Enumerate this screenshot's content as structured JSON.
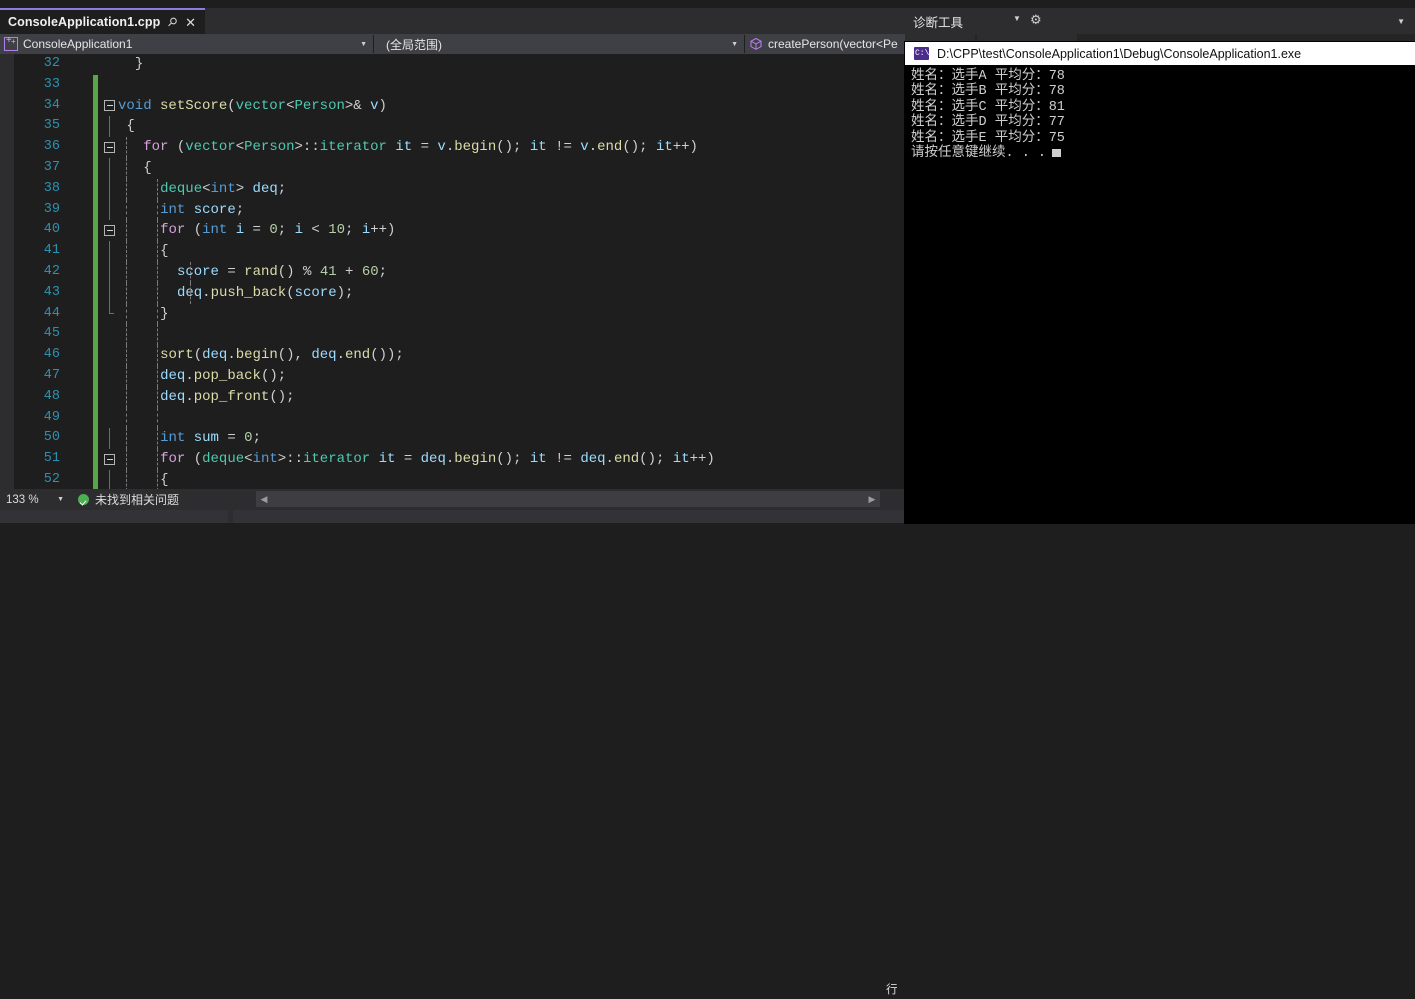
{
  "window": {
    "tab": {
      "title": "ConsoleApplication1.cpp",
      "pin_icon": "pin-icon",
      "close_icon": "close-icon"
    }
  },
  "navbar": {
    "project_selector": "ConsoleApplication1",
    "project_icon": "cpp-project-icon",
    "scope_selector": "(全局范围)",
    "member_selector": "createPerson(vector<Pe",
    "member_icon": "method-cube-icon",
    "dropdown_icon": "chevron-down-icon"
  },
  "diagnostics": {
    "title": "诊断工具",
    "dropdown_icon": "chevron-down-icon",
    "settings_icon": "gear-icon",
    "window_arrow_icon": "chevron-down-icon"
  },
  "console": {
    "title": "D:\\CPP\\test\\ConsoleApplication1\\Debug\\ConsoleApplication1.exe",
    "icon": "console-exe-icon",
    "lines": [
      "姓名：选手A 平均分：78",
      "姓名：选手B 平均分：78",
      "姓名：选手C 平均分：81",
      "姓名：选手D 平均分：77",
      "姓名：选手E 平均分：75",
      "请按任意键继续. . ."
    ],
    "cursor": "block-cursor"
  },
  "statusbar": {
    "zoom": "133 %",
    "zoom_arrow_icon": "chevron-down-icon",
    "issues_icon": "check-circle-icon",
    "issues_text": "未找到相关问题",
    "scroll_left_icon": "caret-left-icon",
    "scroll_right_icon": "caret-right-icon",
    "rowcol_label": "行"
  },
  "editor": {
    "first_line": 32,
    "lines": [
      {
        "n": 32,
        "change": false,
        "glyph": "",
        "guides": 0,
        "indent": 2,
        "tokens": [
          {
            "t": "}",
            "c": "brc"
          }
        ]
      },
      {
        "n": 33,
        "change": true,
        "glyph": "",
        "guides": 0,
        "indent": 0,
        "tokens": []
      },
      {
        "n": 34,
        "change": true,
        "glyph": "collapse",
        "guides": 0,
        "indent": 0,
        "tokens": [
          {
            "t": "void",
            "c": "k"
          },
          {
            "t": " ",
            "c": "pun"
          },
          {
            "t": "setScore",
            "c": "fn"
          },
          {
            "t": "(",
            "c": "brc"
          },
          {
            "t": "vector",
            "c": "typ"
          },
          {
            "t": "<",
            "c": "brc"
          },
          {
            "t": "Person",
            "c": "typ"
          },
          {
            "t": ">& ",
            "c": "brc"
          },
          {
            "t": "v",
            "c": "var"
          },
          {
            "t": ")",
            "c": "brc"
          }
        ]
      },
      {
        "n": 35,
        "change": true,
        "glyph": "vline",
        "guides": 0,
        "indent": 1,
        "tokens": [
          {
            "t": "{",
            "c": "brc"
          }
        ]
      },
      {
        "n": 36,
        "change": true,
        "glyph": "collapse",
        "guides": 1,
        "indent": 3,
        "tokens": [
          {
            "t": "for",
            "c": "kf"
          },
          {
            "t": " (",
            "c": "brc"
          },
          {
            "t": "vector",
            "c": "typ"
          },
          {
            "t": "<",
            "c": "brc"
          },
          {
            "t": "Person",
            "c": "typ"
          },
          {
            "t": ">::",
            "c": "brc"
          },
          {
            "t": "iterator",
            "c": "typ"
          },
          {
            "t": " ",
            "c": "pun"
          },
          {
            "t": "it",
            "c": "var"
          },
          {
            "t": " = ",
            "c": "brc"
          },
          {
            "t": "v",
            "c": "var"
          },
          {
            "t": ".",
            "c": "brc"
          },
          {
            "t": "begin",
            "c": "fn"
          },
          {
            "t": "()",
            "c": "brc"
          },
          {
            "t": "; ",
            "c": "brc"
          },
          {
            "t": "it",
            "c": "var"
          },
          {
            "t": " != ",
            "c": "brc"
          },
          {
            "t": "v",
            "c": "var"
          },
          {
            "t": ".",
            "c": "brc"
          },
          {
            "t": "end",
            "c": "fn"
          },
          {
            "t": "()",
            "c": "brc"
          },
          {
            "t": "; ",
            "c": "brc"
          },
          {
            "t": "it",
            "c": "var"
          },
          {
            "t": "++)",
            "c": "brc"
          }
        ]
      },
      {
        "n": 37,
        "change": true,
        "glyph": "vline",
        "guides": 1,
        "indent": 3,
        "tokens": [
          {
            "t": "{",
            "c": "brc"
          }
        ]
      },
      {
        "n": 38,
        "change": true,
        "glyph": "vline",
        "guides": 2,
        "indent": 5,
        "tokens": [
          {
            "t": "deque",
            "c": "typ"
          },
          {
            "t": "<",
            "c": "brc"
          },
          {
            "t": "int",
            "c": "k"
          },
          {
            "t": "> ",
            "c": "brc"
          },
          {
            "t": "deq",
            "c": "var"
          },
          {
            "t": ";",
            "c": "brc"
          }
        ]
      },
      {
        "n": 39,
        "change": true,
        "glyph": "vline",
        "guides": 2,
        "indent": 5,
        "tokens": [
          {
            "t": "int",
            "c": "k"
          },
          {
            "t": " ",
            "c": "pun"
          },
          {
            "t": "score",
            "c": "var"
          },
          {
            "t": ";",
            "c": "brc"
          }
        ]
      },
      {
        "n": 40,
        "change": true,
        "glyph": "collapse",
        "guides": 2,
        "indent": 5,
        "tokens": [
          {
            "t": "for",
            "c": "kf"
          },
          {
            "t": " (",
            "c": "brc"
          },
          {
            "t": "int",
            "c": "k"
          },
          {
            "t": " ",
            "c": "pun"
          },
          {
            "t": "i",
            "c": "var"
          },
          {
            "t": " = ",
            "c": "brc"
          },
          {
            "t": "0",
            "c": "num"
          },
          {
            "t": "; ",
            "c": "brc"
          },
          {
            "t": "i",
            "c": "var"
          },
          {
            "t": " < ",
            "c": "brc"
          },
          {
            "t": "10",
            "c": "num"
          },
          {
            "t": "; ",
            "c": "brc"
          },
          {
            "t": "i",
            "c": "var"
          },
          {
            "t": "++)",
            "c": "brc"
          }
        ]
      },
      {
        "n": 41,
        "change": true,
        "glyph": "vline",
        "guides": 2,
        "indent": 5,
        "tokens": [
          {
            "t": "{",
            "c": "brc"
          }
        ]
      },
      {
        "n": 42,
        "change": true,
        "glyph": "vline",
        "guides": 3,
        "indent": 7,
        "tokens": [
          {
            "t": "score",
            "c": "var"
          },
          {
            "t": " = ",
            "c": "brc"
          },
          {
            "t": "rand",
            "c": "fn"
          },
          {
            "t": "()",
            "c": "brc"
          },
          {
            "t": " % ",
            "c": "brc"
          },
          {
            "t": "41",
            "c": "num"
          },
          {
            "t": " + ",
            "c": "brc"
          },
          {
            "t": "60",
            "c": "num"
          },
          {
            "t": ";",
            "c": "brc"
          }
        ]
      },
      {
        "n": 43,
        "change": true,
        "glyph": "vline",
        "guides": 3,
        "indent": 7,
        "tokens": [
          {
            "t": "deq",
            "c": "var"
          },
          {
            "t": ".",
            "c": "brc"
          },
          {
            "t": "push_back",
            "c": "fn"
          },
          {
            "t": "(",
            "c": "brc"
          },
          {
            "t": "score",
            "c": "var"
          },
          {
            "t": ");",
            "c": "brc"
          }
        ]
      },
      {
        "n": 44,
        "change": true,
        "glyph": "vline-end",
        "guides": 2,
        "indent": 5,
        "tokens": [
          {
            "t": "}",
            "c": "brc"
          }
        ]
      },
      {
        "n": 45,
        "change": true,
        "glyph": "",
        "guides": 2,
        "indent": 0,
        "tokens": []
      },
      {
        "n": 46,
        "change": true,
        "glyph": "",
        "guides": 2,
        "indent": 5,
        "tokens": [
          {
            "t": "sort",
            "c": "fn"
          },
          {
            "t": "(",
            "c": "brc"
          },
          {
            "t": "deq",
            "c": "var"
          },
          {
            "t": ".",
            "c": "brc"
          },
          {
            "t": "begin",
            "c": "fn"
          },
          {
            "t": "(), ",
            "c": "brc"
          },
          {
            "t": "deq",
            "c": "var"
          },
          {
            "t": ".",
            "c": "brc"
          },
          {
            "t": "end",
            "c": "fn"
          },
          {
            "t": "());",
            "c": "brc"
          }
        ]
      },
      {
        "n": 47,
        "change": true,
        "glyph": "",
        "guides": 2,
        "indent": 5,
        "tokens": [
          {
            "t": "deq",
            "c": "var"
          },
          {
            "t": ".",
            "c": "brc"
          },
          {
            "t": "pop_back",
            "c": "fn"
          },
          {
            "t": "();",
            "c": "brc"
          }
        ]
      },
      {
        "n": 48,
        "change": true,
        "glyph": "",
        "guides": 2,
        "indent": 5,
        "tokens": [
          {
            "t": "deq",
            "c": "var"
          },
          {
            "t": ".",
            "c": "brc"
          },
          {
            "t": "pop_front",
            "c": "fn"
          },
          {
            "t": "();",
            "c": "brc"
          }
        ]
      },
      {
        "n": 49,
        "change": true,
        "glyph": "",
        "guides": 2,
        "indent": 0,
        "tokens": []
      },
      {
        "n": 50,
        "change": true,
        "glyph": "vline",
        "guides": 2,
        "indent": 5,
        "tokens": [
          {
            "t": "int",
            "c": "k"
          },
          {
            "t": " ",
            "c": "pun"
          },
          {
            "t": "sum",
            "c": "var"
          },
          {
            "t": " = ",
            "c": "brc"
          },
          {
            "t": "0",
            "c": "num"
          },
          {
            "t": ";",
            "c": "brc"
          }
        ]
      },
      {
        "n": 51,
        "change": true,
        "glyph": "collapse",
        "guides": 2,
        "indent": 5,
        "tokens": [
          {
            "t": "for",
            "c": "kf"
          },
          {
            "t": " (",
            "c": "brc"
          },
          {
            "t": "deque",
            "c": "typ"
          },
          {
            "t": "<",
            "c": "brc"
          },
          {
            "t": "int",
            "c": "k"
          },
          {
            "t": ">::",
            "c": "brc"
          },
          {
            "t": "iterator",
            "c": "typ"
          },
          {
            "t": " ",
            "c": "pun"
          },
          {
            "t": "it",
            "c": "var"
          },
          {
            "t": " = ",
            "c": "brc"
          },
          {
            "t": "deq",
            "c": "var"
          },
          {
            "t": ".",
            "c": "brc"
          },
          {
            "t": "begin",
            "c": "fn"
          },
          {
            "t": "()",
            "c": "brc"
          },
          {
            "t": "; ",
            "c": "brc"
          },
          {
            "t": "it",
            "c": "var"
          },
          {
            "t": " != ",
            "c": "brc"
          },
          {
            "t": "deq",
            "c": "var"
          },
          {
            "t": ".",
            "c": "brc"
          },
          {
            "t": "end",
            "c": "fn"
          },
          {
            "t": "()",
            "c": "brc"
          },
          {
            "t": "; ",
            "c": "brc"
          },
          {
            "t": "it",
            "c": "var"
          },
          {
            "t": "++)",
            "c": "brc"
          }
        ]
      },
      {
        "n": 52,
        "change": true,
        "glyph": "vline",
        "guides": 2,
        "indent": 5,
        "tokens": [
          {
            "t": "{",
            "c": "brc"
          }
        ]
      }
    ]
  },
  "colors": {
    "editor_bg": "#1e1e1e",
    "chrome_bg": "#2d2d30",
    "navbar_bg": "#3f3f46",
    "tab_accent": "#8a7fe0",
    "linenum": "#2b91af",
    "change_bar": "#57a64a",
    "console_bg": "#000000",
    "console_fg": "#cfcfcf"
  }
}
